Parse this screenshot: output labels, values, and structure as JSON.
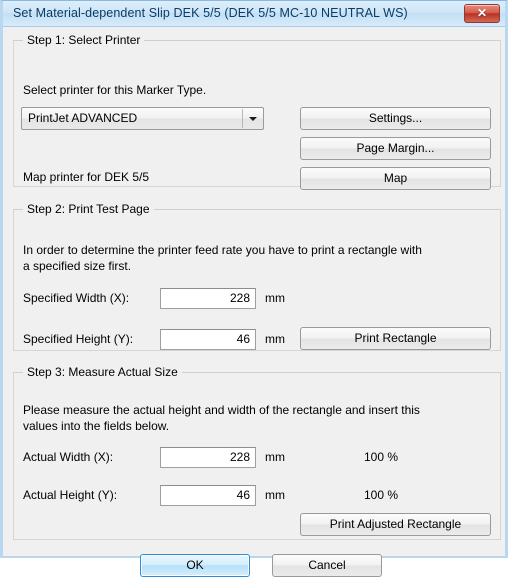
{
  "window": {
    "title": "Set Material-dependent Slip DEK 5/5 (DEK 5/5 MC-10 NEUTRAL WS)",
    "close_glyph": "✕"
  },
  "step1": {
    "legend": "Step 1: Select Printer",
    "instruction": "Select printer for this Marker Type.",
    "printer_combo": {
      "value": "PrintJet ADVANCED",
      "options": [
        "PrintJet ADVANCED"
      ]
    },
    "map_label": "Map printer for DEK 5/5",
    "settings_button": "Settings...",
    "page_margin_button": "Page Margin...",
    "map_button": "Map"
  },
  "step2": {
    "legend": "Step 2: Print Test Page",
    "description_line1": "In order to determine the printer feed rate you have to print a rectangle with",
    "description_line2": "a specified size first.",
    "width_label": "Specified Width (X):",
    "width_value": "228",
    "width_unit": "mm",
    "height_label": "Specified Height (Y):",
    "height_value": "46",
    "height_unit": "mm",
    "print_rectangle_button": "Print Rectangle"
  },
  "step3": {
    "legend": "Step 3: Measure Actual Size",
    "description_line1": "Please measure the actual height and width of the rectangle and insert this",
    "description_line2": "values into the fields below.",
    "width_label": "Actual Width (X):",
    "width_value": "228",
    "width_unit": "mm",
    "width_percent": "100 %",
    "height_label": "Actual Height (Y):",
    "height_value": "46",
    "height_unit": "mm",
    "height_percent": "100 %",
    "print_adjusted_button": "Print Adjusted Rectangle"
  },
  "footer": {
    "ok_button": "OK",
    "cancel_button": "Cancel"
  },
  "colors": {
    "titlebar_text": "#0b3c63",
    "close_button": "#b83224",
    "default_button_border": "#2c8dd9",
    "dialog_background": "#f0f0f0",
    "groupbox_border": "#d5d5d5"
  }
}
